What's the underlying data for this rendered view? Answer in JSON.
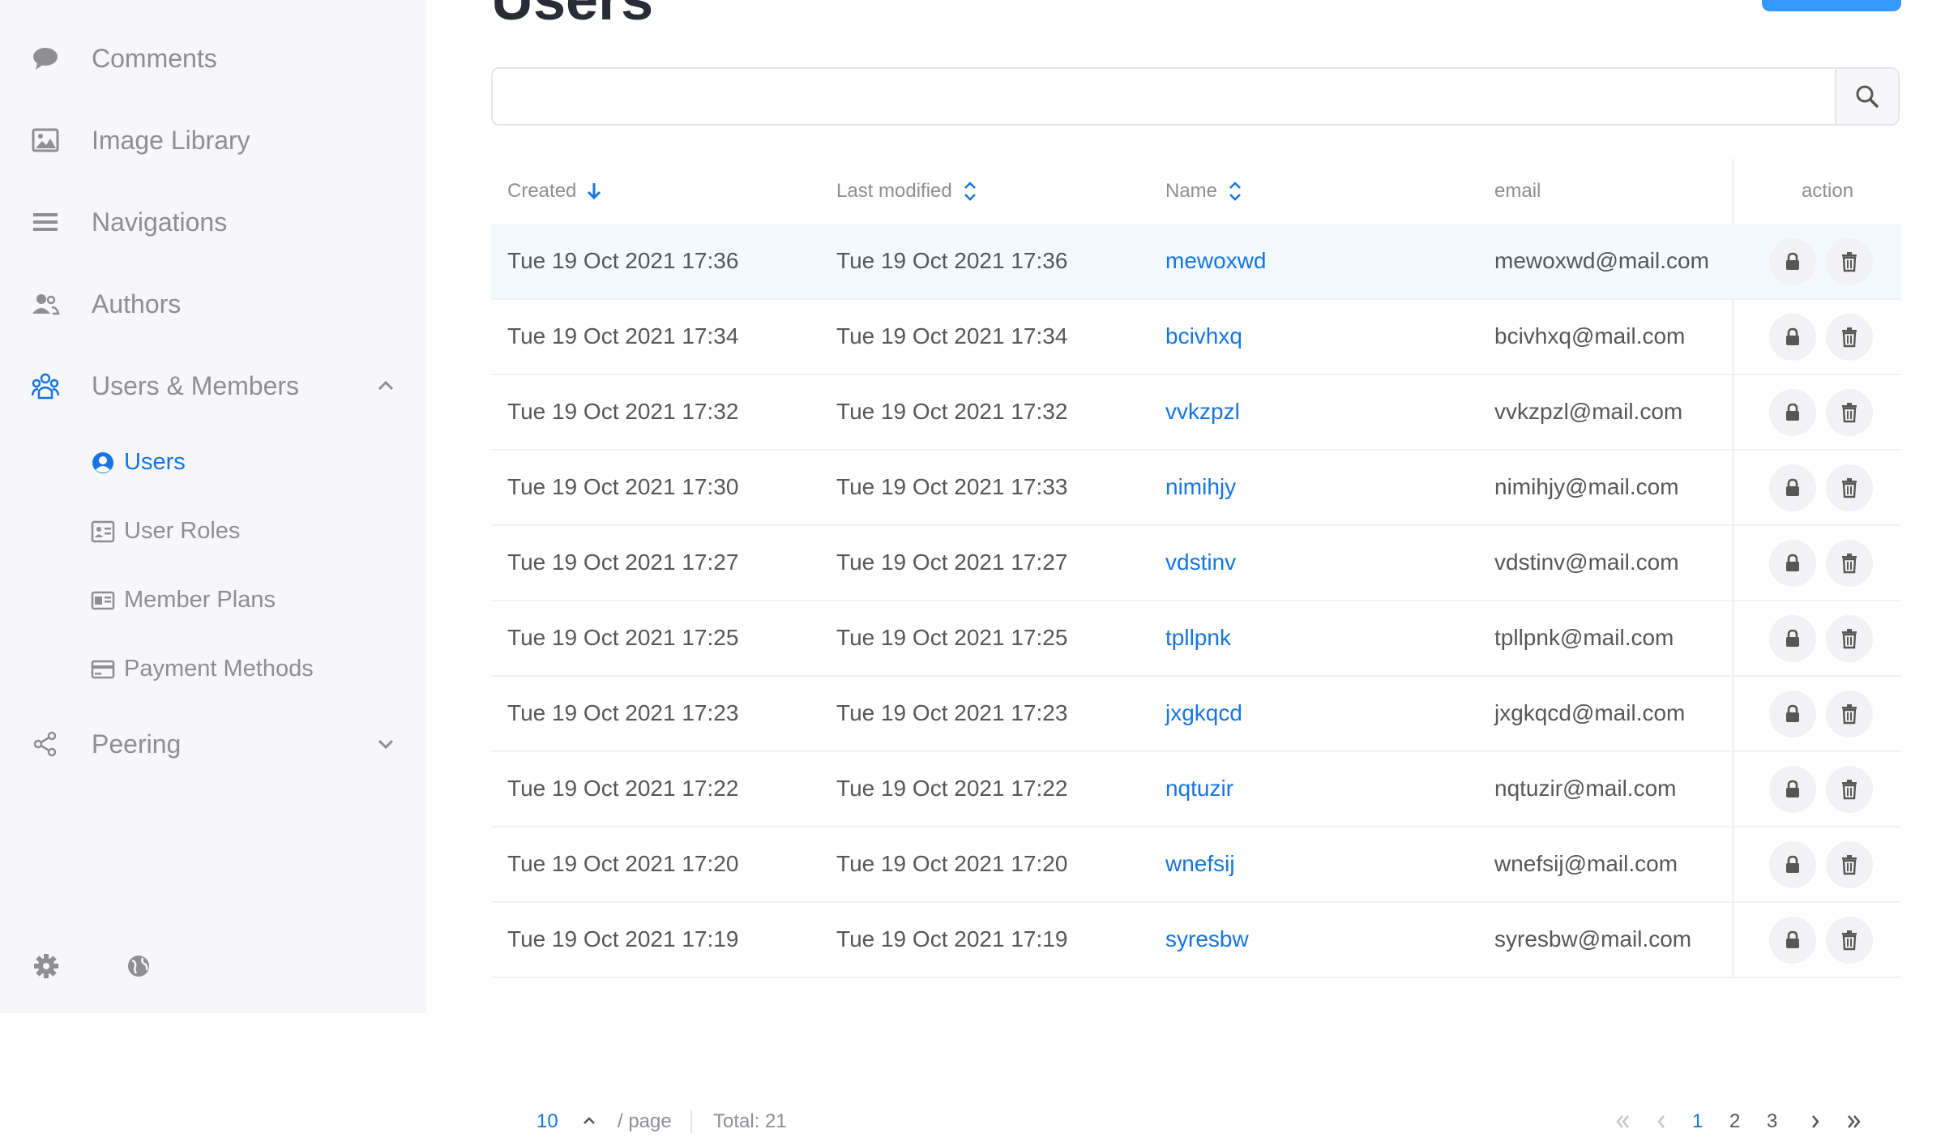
{
  "sidebar": {
    "items": [
      {
        "label": "Comments"
      },
      {
        "label": "Image Library"
      },
      {
        "label": "Navigations"
      },
      {
        "label": "Authors"
      },
      {
        "label": "Users & Members"
      },
      {
        "label": "Peering"
      }
    ],
    "subitems": [
      {
        "label": "Users"
      },
      {
        "label": "User Roles"
      },
      {
        "label": "Member Plans"
      },
      {
        "label": "Payment Methods"
      }
    ]
  },
  "page": {
    "title": "Users"
  },
  "search": {
    "placeholder": "",
    "value": ""
  },
  "table": {
    "headers": {
      "created": "Created",
      "modified": "Last modified",
      "name": "Name",
      "email": "email",
      "action": "action"
    },
    "rows": [
      {
        "created": "Tue 19 Oct 2021 17:36",
        "modified": "Tue 19 Oct 2021 17:36",
        "name": "mewoxwd",
        "email": "mewoxwd@mail.com"
      },
      {
        "created": "Tue 19 Oct 2021 17:34",
        "modified": "Tue 19 Oct 2021 17:34",
        "name": "bcivhxq",
        "email": "bcivhxq@mail.com"
      },
      {
        "created": "Tue 19 Oct 2021 17:32",
        "modified": "Tue 19 Oct 2021 17:32",
        "name": "vvkzpzl",
        "email": "vvkzpzl@mail.com"
      },
      {
        "created": "Tue 19 Oct 2021 17:30",
        "modified": "Tue 19 Oct 2021 17:33",
        "name": "nimihjy",
        "email": "nimihjy@mail.com"
      },
      {
        "created": "Tue 19 Oct 2021 17:27",
        "modified": "Tue 19 Oct 2021 17:27",
        "name": "vdstinv",
        "email": "vdstinv@mail.com"
      },
      {
        "created": "Tue 19 Oct 2021 17:25",
        "modified": "Tue 19 Oct 2021 17:25",
        "name": "tpllpnk",
        "email": "tpllpnk@mail.com"
      },
      {
        "created": "Tue 19 Oct 2021 17:23",
        "modified": "Tue 19 Oct 2021 17:23",
        "name": "jxgkqcd",
        "email": "jxgkqcd@mail.com"
      },
      {
        "created": "Tue 19 Oct 2021 17:22",
        "modified": "Tue 19 Oct 2021 17:22",
        "name": "nqtuzir",
        "email": "nqtuzir@mail.com"
      },
      {
        "created": "Tue 19 Oct 2021 17:20",
        "modified": "Tue 19 Oct 2021 17:20",
        "name": "wnefsij",
        "email": "wnefsij@mail.com"
      },
      {
        "created": "Tue 19 Oct 2021 17:19",
        "modified": "Tue 19 Oct 2021 17:19",
        "name": "syresbw",
        "email": "syresbw@mail.com"
      }
    ]
  },
  "pagination": {
    "page_size": "10",
    "per_page_label": "/ page",
    "total_label": "Total: 21",
    "pages": [
      "1",
      "2",
      "3"
    ],
    "active_page": "1"
  },
  "colors": {
    "accent": "#1675e0",
    "primary_button": "#3498ff",
    "sidebar_bg": "#f7f7fa",
    "row_highlight": "#f2faff"
  },
  "icons": {
    "sidebar": [
      "comment-icon",
      "image-icon",
      "menu-icon",
      "authors-icon",
      "users-members-icon",
      "share-icon"
    ],
    "subitems": [
      "user-circle-icon",
      "user-roles-icon",
      "member-plans-icon",
      "payment-methods-icon"
    ],
    "footer": [
      "gear-icon",
      "globe-icon"
    ],
    "row_actions": [
      "lock-icon",
      "trash-icon"
    ]
  }
}
